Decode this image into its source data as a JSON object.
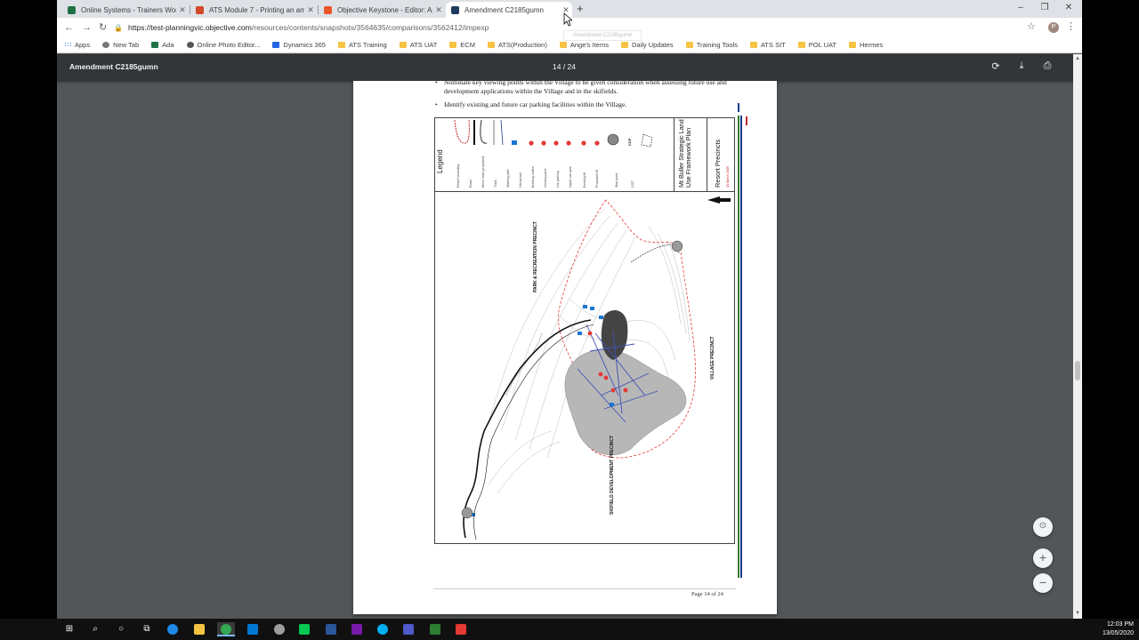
{
  "tabs": [
    {
      "title": "Online Systems - Trainers Workir",
      "color": "#1e7145"
    },
    {
      "title": "ATS Module 7 - Printing an amen",
      "color": "#d24726"
    },
    {
      "title": "Objective Keystone - Editor: Amu",
      "color": "#e8562a"
    },
    {
      "title": "Amendment C2185gumn",
      "color": "#1f3a5f"
    }
  ],
  "omnibox": {
    "host": "https://test-planningvic.objective.com",
    "path": "/resources/contents/snapshots/3564635/comparisons/3562412/impexp"
  },
  "bookmarks": [
    "Apps",
    "New Tab",
    "Ada",
    "Online Photo Editor...",
    "Dynamics 365",
    "ATS Training",
    "ATS UAT",
    "ECM",
    "ATS(Production)",
    "Ange's Items",
    "Daily Updates",
    "Training Tools",
    "ATS SIT",
    "POL UAT",
    "Hermes"
  ],
  "pdf": {
    "title": "Amendment C2185gumn",
    "page_indicator": "14 / 24",
    "bullets": [
      "Nominate key viewing points within the Village to be given consideration when assessing future use and development applications within the Village and in the skifields.",
      "Identify existing and future car parking facilities within the Village."
    ],
    "legend_title": "Legend",
    "legend_items": [
      "Resort boundary",
      "Road",
      "Minor road (proposed)",
      "Trails",
      "Walking path",
      "Hiking trail",
      "Building outline",
      "Viewing point",
      "Car parking",
      "Upper car park",
      "Existing lift",
      "Proposed lift",
      "Stop point",
      "CCP"
    ],
    "plan_title": "Mt Buller Strategic Land Use Framework Plan",
    "plan_subtitle": "Resort Precincts",
    "plan_date": "30 March 2009",
    "map_labels": {
      "park": "PARK & RECREATION PRECINCT",
      "village": "VILLAGE PRECINCT",
      "skifield": "SKIFIELD DEVELOPMENT PRECINCT"
    },
    "page_footer": "Page 14 of 24"
  },
  "taskbar": {
    "time": "12:03 PM",
    "date": "13/05/2020"
  }
}
